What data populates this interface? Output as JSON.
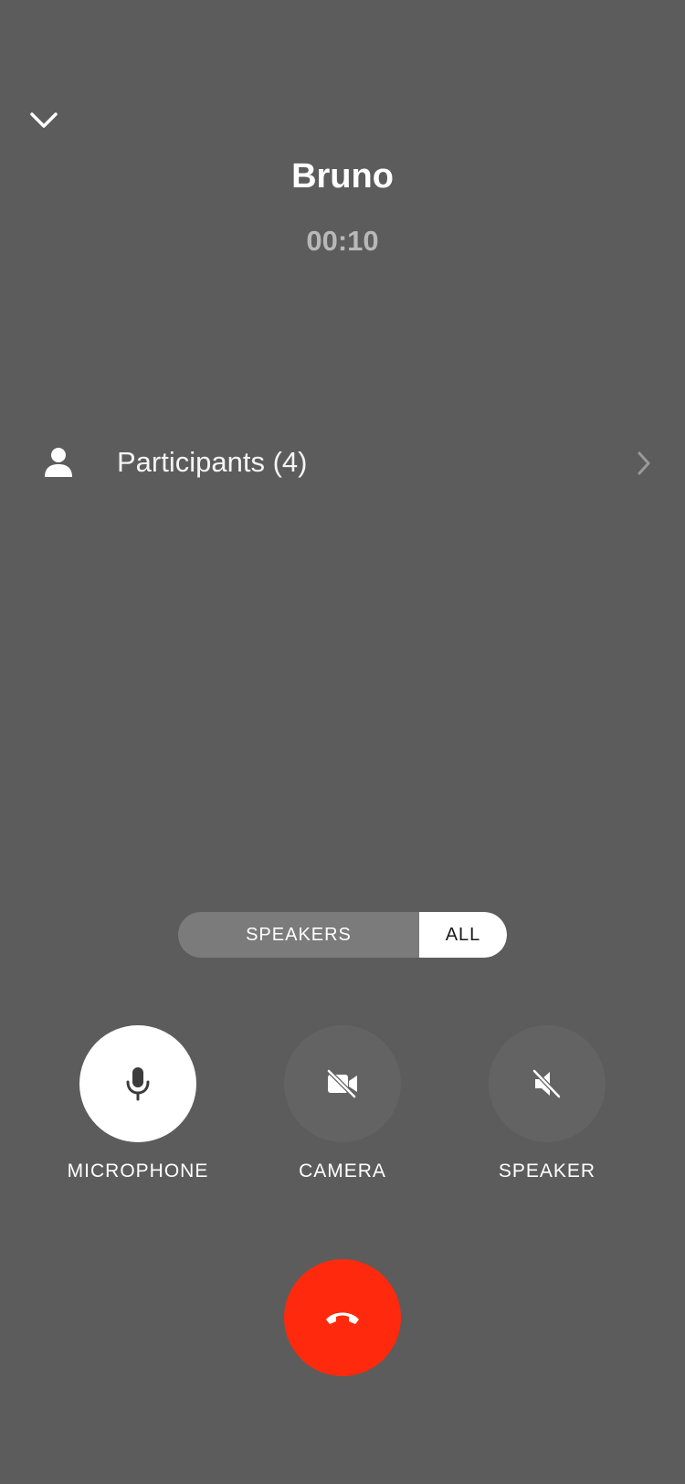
{
  "call": {
    "caller_name": "Bruno",
    "timer": "00:10"
  },
  "participants": {
    "label": "Participants (4)",
    "icon": "person-icon"
  },
  "view_toggle": {
    "options": [
      "SPEAKERS",
      "ALL"
    ],
    "selected": "ALL"
  },
  "controls": [
    {
      "label": "MICROPHONE",
      "icon": "microphone-icon",
      "state": "on"
    },
    {
      "label": "CAMERA",
      "icon": "camera-off-icon",
      "state": "off"
    },
    {
      "label": "SPEAKER",
      "icon": "speaker-muted-icon",
      "state": "off"
    }
  ],
  "end_call": {
    "icon": "hang-up-icon"
  },
  "colors": {
    "background": "#5c5c5c",
    "end_call": "#ff2a0d",
    "timer": "#b8b8b8",
    "toggle_track": "#7b7b7b",
    "control_off": "#636363"
  }
}
